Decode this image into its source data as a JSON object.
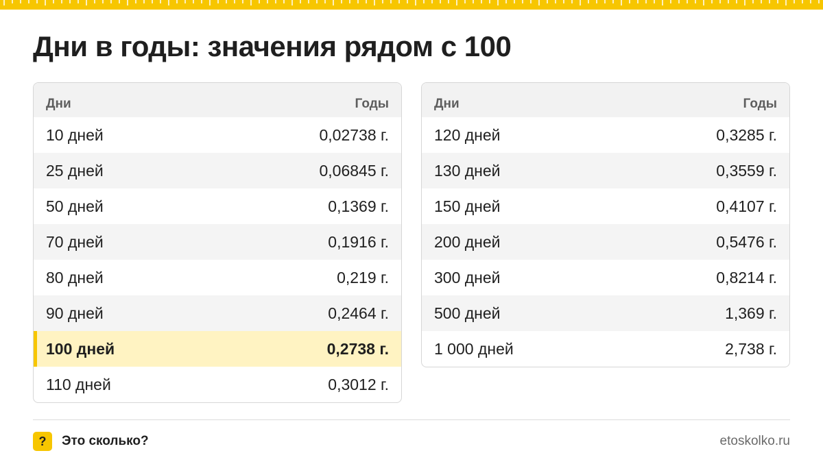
{
  "header": {
    "title": "Дни в годы: значения рядом с 100"
  },
  "colors": {
    "accent": "#f7c600",
    "highlight_row": "#fff3c2",
    "header_row": "#f2f2f2"
  },
  "tables": [
    {
      "headers": {
        "days": "Дни",
        "years": "Годы"
      },
      "rows": [
        {
          "days": "10 дней",
          "years": "0,02738 г."
        },
        {
          "days": "25 дней",
          "years": "0,06845 г."
        },
        {
          "days": "50 дней",
          "years": "0,1369 г."
        },
        {
          "days": "70 дней",
          "years": "0,1916 г."
        },
        {
          "days": "80 дней",
          "years": "0,219 г."
        },
        {
          "days": "90 дней",
          "years": "0,2464 г."
        },
        {
          "days": "100 дней",
          "years": "0,2738 г.",
          "highlighted": true
        },
        {
          "days": "110 дней",
          "years": "0,3012 г."
        }
      ]
    },
    {
      "headers": {
        "days": "Дни",
        "years": "Годы"
      },
      "rows": [
        {
          "days": "120 дней",
          "years": "0,3285 г."
        },
        {
          "days": "130 дней",
          "years": "0,3559 г."
        },
        {
          "days": "150 дней",
          "years": "0,4107 г."
        },
        {
          "days": "200 дней",
          "years": "0,5476 г."
        },
        {
          "days": "300 дней",
          "years": "0,8214 г."
        },
        {
          "days": "500 дней",
          "years": "1,369 г."
        },
        {
          "days": "1 000 дней",
          "years": "2,738 г."
        }
      ]
    }
  ],
  "footer": {
    "badge": "?",
    "brand_name": "Это сколько?",
    "site": "etoskolko.ru"
  }
}
